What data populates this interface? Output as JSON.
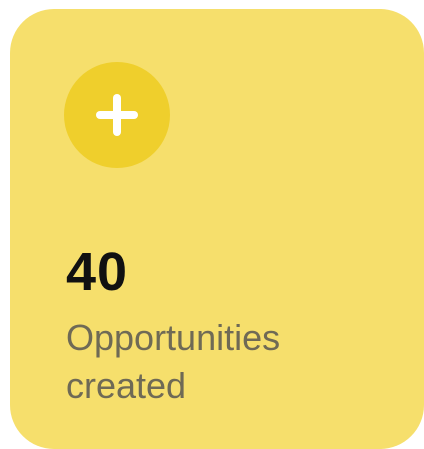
{
  "card": {
    "background_color": "#f6df6c",
    "icon": {
      "name": "plus-icon",
      "circle_color": "#efcf2c",
      "glyph_color": "#ffffff"
    },
    "value": "40",
    "label": "Opportunities created"
  }
}
